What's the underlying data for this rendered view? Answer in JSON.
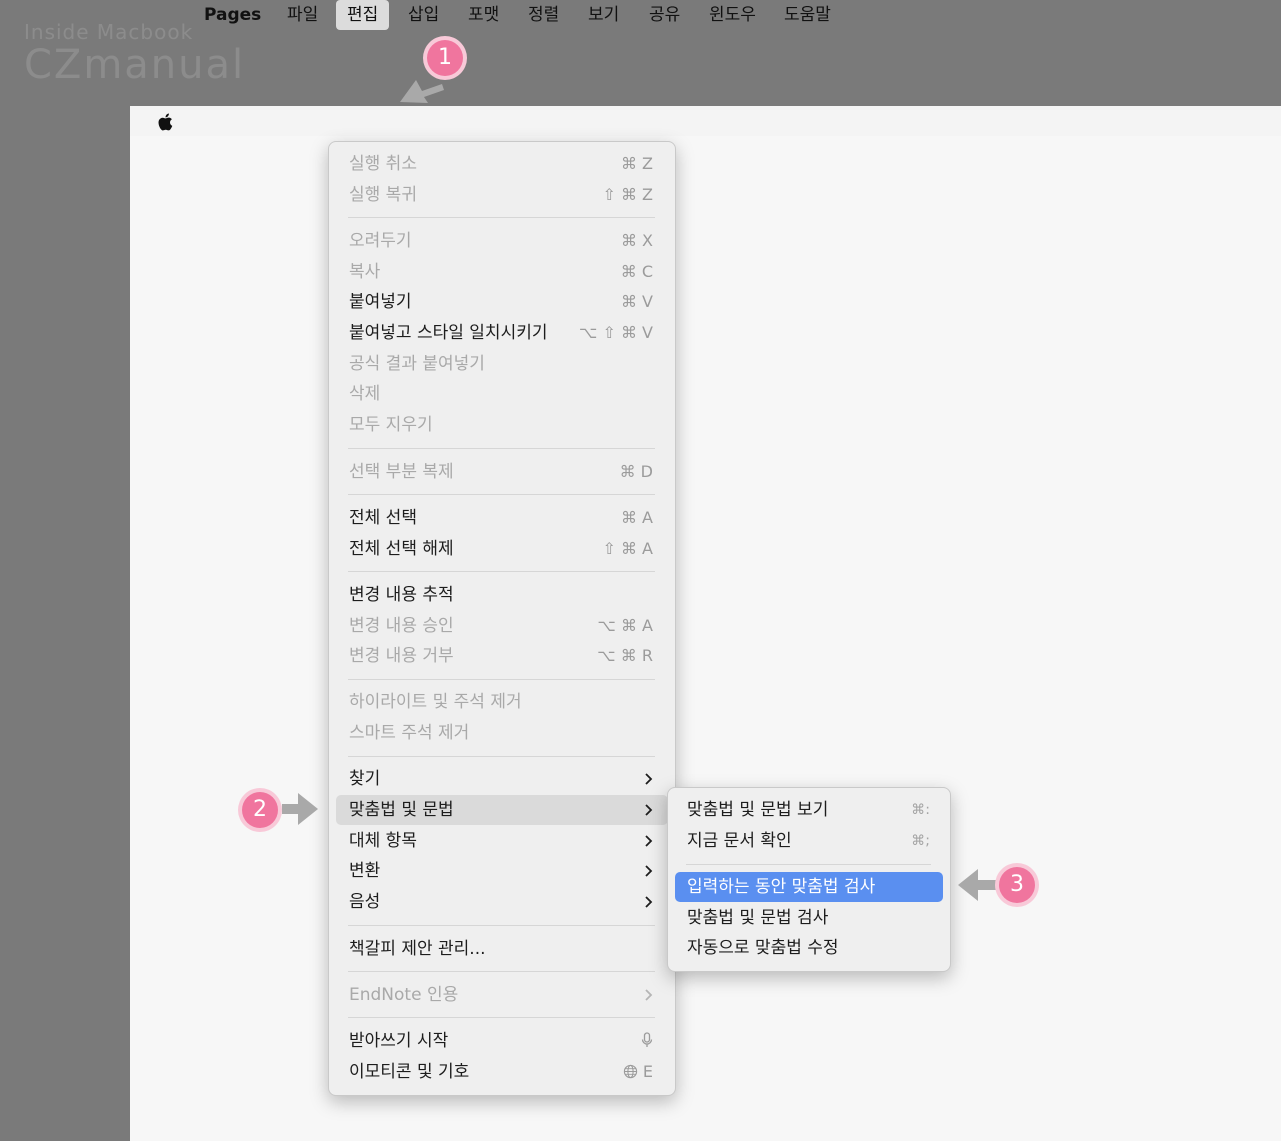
{
  "watermark": {
    "line1": "Inside Macbook",
    "line2": "CZmanual"
  },
  "menubar": {
    "app_name": "Pages",
    "items": [
      "파일",
      "편집",
      "삽입",
      "포맷",
      "정렬",
      "보기",
      "공유",
      "윈도우",
      "도움말"
    ],
    "active_item": "편집"
  },
  "edit_menu": {
    "items": [
      {
        "label": "실행 취소",
        "shortcut": "⌘ Z",
        "enabled": false
      },
      {
        "label": "실행 복귀",
        "shortcut": "⇧ ⌘ Z",
        "enabled": false
      },
      {
        "label": "오려두기",
        "shortcut": "⌘ X",
        "enabled": false
      },
      {
        "label": "복사",
        "shortcut": "⌘ C",
        "enabled": false
      },
      {
        "label": "붙여넣기",
        "shortcut": "⌘ V",
        "enabled": true
      },
      {
        "label": "붙여넣고 스타일 일치시키기",
        "shortcut": "⌥ ⇧ ⌘ V",
        "enabled": true
      },
      {
        "label": "공식 결과 붙여넣기",
        "shortcut": "",
        "enabled": false
      },
      {
        "label": "삭제",
        "shortcut": "",
        "enabled": false
      },
      {
        "label": "모두 지우기",
        "shortcut": "",
        "enabled": false
      },
      {
        "label": "선택 부분 복제",
        "shortcut": "⌘ D",
        "enabled": false
      },
      {
        "label": "전체 선택",
        "shortcut": "⌘ A",
        "enabled": true
      },
      {
        "label": "전체 선택 해제",
        "shortcut": "⇧ ⌘ A",
        "enabled": true
      },
      {
        "label": "변경 내용 추적",
        "shortcut": "",
        "enabled": true
      },
      {
        "label": "변경 내용 승인",
        "shortcut": "⌥ ⌘ A",
        "enabled": false
      },
      {
        "label": "변경 내용 거부",
        "shortcut": "⌥ ⌘ R",
        "enabled": false
      },
      {
        "label": "하이라이트 및 주석 제거",
        "shortcut": "",
        "enabled": false
      },
      {
        "label": "스마트 주석 제거",
        "shortcut": "",
        "enabled": false
      },
      {
        "label": "찾기",
        "submenu": true,
        "enabled": true
      },
      {
        "label": "맞춤법 및 문법",
        "submenu": true,
        "enabled": true,
        "highlighted": true
      },
      {
        "label": "대체 항목",
        "submenu": true,
        "enabled": true
      },
      {
        "label": "변환",
        "submenu": true,
        "enabled": true
      },
      {
        "label": "음성",
        "submenu": true,
        "enabled": true
      },
      {
        "label": "책갈피 제안 관리...",
        "shortcut": "",
        "enabled": true
      },
      {
        "label": "EndNote 인용",
        "submenu": true,
        "enabled": false
      },
      {
        "label": "받아쓰기 시작",
        "shortcut_icon": "microphone-icon",
        "enabled": true
      },
      {
        "label": "이모티콘 및 기호",
        "shortcut": "E",
        "shortcut_icon": "globe-icon",
        "enabled": true
      }
    ]
  },
  "spelling_submenu": {
    "items": [
      {
        "label": "맞춤법 및 문법 보기",
        "shortcut": "⌘:"
      },
      {
        "label": "지금 문서 확인",
        "shortcut": "⌘;"
      },
      {
        "label": "입력하는 동안 맞춤법 검사",
        "selected": true
      },
      {
        "label": "맞춤법 및 문법 검사"
      },
      {
        "label": "자동으로 맞춤법 수정"
      }
    ]
  },
  "annotations": {
    "badge1": "1",
    "badge2": "2",
    "badge3": "3",
    "badge_color": "#f0759e"
  }
}
